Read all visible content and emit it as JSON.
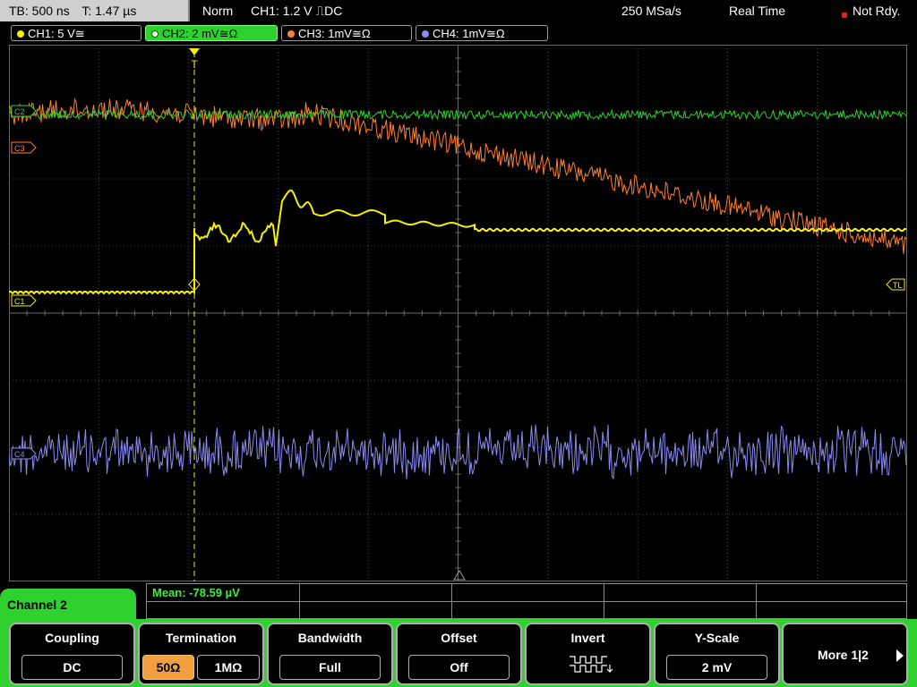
{
  "status": {
    "timebase": "TB: 500 ns",
    "trigger_time": "T: 1.47 µs",
    "mode": "Norm",
    "trigger": "CH1: 1.2 V ⎍DC",
    "sample_rate": "250 MSa/s",
    "acq_mode": "Real Time",
    "state": "Not Rdy."
  },
  "channels": [
    {
      "label": "CH1: 5 V≅",
      "color": "#f5f000"
    },
    {
      "label": "CH2: 2 mV≅Ω",
      "color": "#2ed12e"
    },
    {
      "label": "CH3: 1mV≅Ω",
      "color": "#ff8030"
    },
    {
      "label": "CH4: 1mV≅Ω",
      "color": "#8a8af0"
    }
  ],
  "markers": {
    "c1": "C1",
    "c2": "C2",
    "c3": "C3",
    "c4": "C4",
    "trigger_level": "TL",
    "trigger_pos": "T"
  },
  "measurement": {
    "mean": "Mean: -78.59 µV"
  },
  "menu": {
    "tab": "Channel 2",
    "coupling_title": "Coupling",
    "coupling_value": "DC",
    "termination_title": "Termination",
    "termination_opt1": "50Ω",
    "termination_opt2": "1MΩ",
    "bandwidth_title": "Bandwidth",
    "bandwidth_value": "Full",
    "offset_title": "Offset",
    "offset_value": "Off",
    "invert_title": "Invert",
    "yscale_title": "Y-Scale",
    "yscale_value": "2 mV",
    "more_label": "More 1|2"
  }
}
